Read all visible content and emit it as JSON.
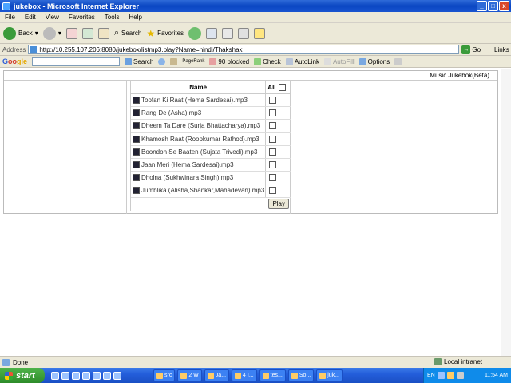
{
  "window": {
    "title": "jukebox - Microsoft Internet Explorer",
    "buttons": {
      "minimize": "_",
      "maximize": "□",
      "close": "x"
    }
  },
  "menu": [
    "File",
    "Edit",
    "View",
    "Favorites",
    "Tools",
    "Help"
  ],
  "toolbar": {
    "back": "Back",
    "search": "Search",
    "favorites": "Favorites"
  },
  "address": {
    "label": "Address",
    "url": "http://10.255.107.206:8080/jukebox/listmp3.play?Name=hindi/Thakshak",
    "go": "Go",
    "links": "Links"
  },
  "google": {
    "logo_g1": "G",
    "logo_g2": "oo",
    "logo_g3": "gle",
    "search": "Search",
    "pagerank": "PageRank",
    "blocked": "90 blocked",
    "check": "Check",
    "autolink": "AutoLink",
    "autofill": "AutoFill",
    "options": "Options"
  },
  "page": {
    "app_title": "Music Jukebok(Beta)",
    "table": {
      "name_header": "Name",
      "all_header": "All",
      "songs": [
        "Toofan Ki Raat (Hema Sardesai).mp3",
        "Rang De (Asha).mp3",
        "Dheem Ta Dare (Surja Bhattacharya).mp3",
        "Khamosh Raat (Roopkumar Rathod).mp3",
        "Boondon Se Baaten (Sujata Trivedi).mp3",
        "Jaan Meri (Hema Sardesai).mp3",
        "Dholna (Sukhwinara Singh).mp3",
        "Jumblika (Alisha,Shankar,Mahadevan).mp3"
      ],
      "play_label": "Play"
    }
  },
  "status": {
    "text": "Done",
    "zone": "Local intranet"
  },
  "taskbar": {
    "start": "start",
    "tasks": [
      "src",
      "2 W",
      "Ja...",
      "4 I...",
      "tes...",
      "So...",
      "juk..."
    ],
    "lang": "EN",
    "clock": "11:54 AM"
  },
  "colors": {
    "titlebar": "#0a46c2",
    "chrome": "#ece9d8",
    "start": "#2e8c2a"
  }
}
